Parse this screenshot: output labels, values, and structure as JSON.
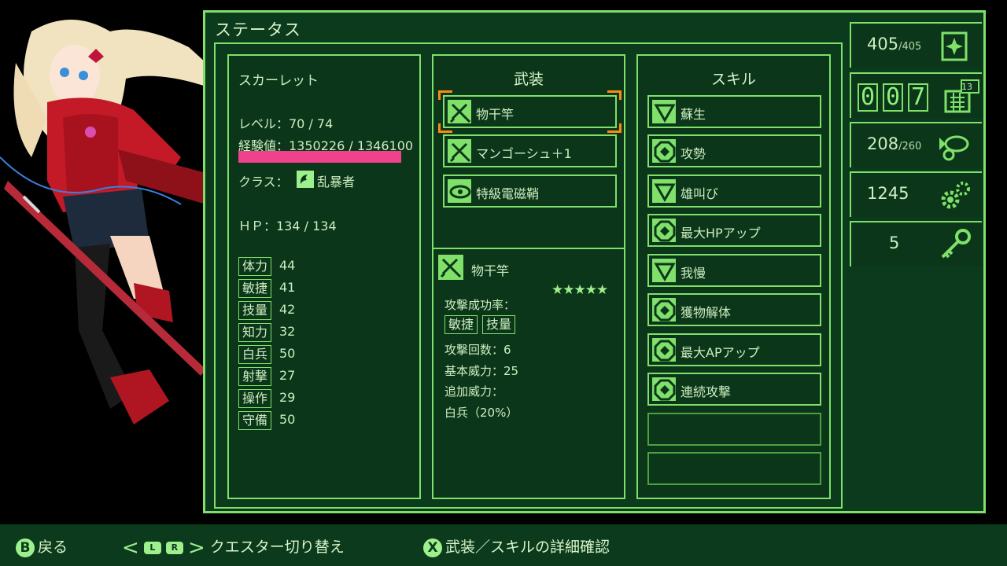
{
  "panel": {
    "title": "ステータス"
  },
  "status": {
    "name": "スカーレット",
    "level": "レベル：70 / 74",
    "exp": "経験値：1350226 / 1346100",
    "class_label": "クラス：",
    "class_value": "乱暴者",
    "hp": "ＨＰ：134 / 134",
    "stats": [
      {
        "label": "体力",
        "value": "44"
      },
      {
        "label": "敏捷",
        "value": "41"
      },
      {
        "label": "技量",
        "value": "42"
      },
      {
        "label": "知力",
        "value": "32"
      },
      {
        "label": "白兵",
        "value": "50"
      },
      {
        "label": "射撃",
        "value": "27"
      },
      {
        "label": "操作",
        "value": "29"
      },
      {
        "label": "守備",
        "value": "50"
      }
    ]
  },
  "weapons": {
    "header": "武装",
    "slots": [
      {
        "label": "物干竿",
        "icon": "sword-icon",
        "selected": true
      },
      {
        "label": "マンゴーシュ＋1",
        "icon": "sword-icon"
      },
      {
        "label": "特級電磁鞘",
        "icon": "eye-icon"
      }
    ],
    "detail": {
      "name": "物干竿",
      "stars": "★★★★★",
      "hit_rate_label": "攻撃成功率：",
      "hit_tags": [
        "敏捷",
        "技量"
      ],
      "attack_count": "攻撃回数：6",
      "base_power": "基本威力：25",
      "extra_power_label": "追加威力：",
      "extra_power": "白兵（20%）"
    }
  },
  "skills": {
    "header": "スキル",
    "items": [
      {
        "label": "蘇生",
        "icon": "triangle-icon"
      },
      {
        "label": "攻勢",
        "icon": "octagon-icon"
      },
      {
        "label": "雄叫び",
        "icon": "triangle-icon"
      },
      {
        "label": "最大HPアップ",
        "icon": "octagon-icon"
      },
      {
        "label": "我慢",
        "icon": "triangle-icon"
      },
      {
        "label": "獲物解体",
        "icon": "octagon-icon"
      },
      {
        "label": "最大APアップ",
        "icon": "octagon-icon"
      },
      {
        "label": "連続攻撃",
        "icon": "octagon-icon"
      }
    ],
    "empty_slots": 2
  },
  "resources": {
    "ap": {
      "value": "405",
      "max": "/405",
      "icon": "sparkle-card-icon"
    },
    "day_digits": [
      "0",
      "0",
      "7"
    ],
    "calendar_badge": "13",
    "food": {
      "value": "208",
      "max": "/260",
      "icon": "fish-icon"
    },
    "parts": {
      "value": "1245",
      "icon": "gears-icon"
    },
    "keys": {
      "value": "5",
      "icon": "key-icon"
    }
  },
  "bottom": {
    "back_btn": "B",
    "back": "戻る",
    "switch_l": "L",
    "switch_r": "R",
    "switch": "クエスター切り替え",
    "detail_btn": "X",
    "detail": "武装／スキルの詳細確認"
  },
  "colors": {
    "accent": "#7fe06a",
    "panel_bg": "#0c3a1c",
    "exp_bar": "#f0418c",
    "selection": "#ff8a12"
  }
}
